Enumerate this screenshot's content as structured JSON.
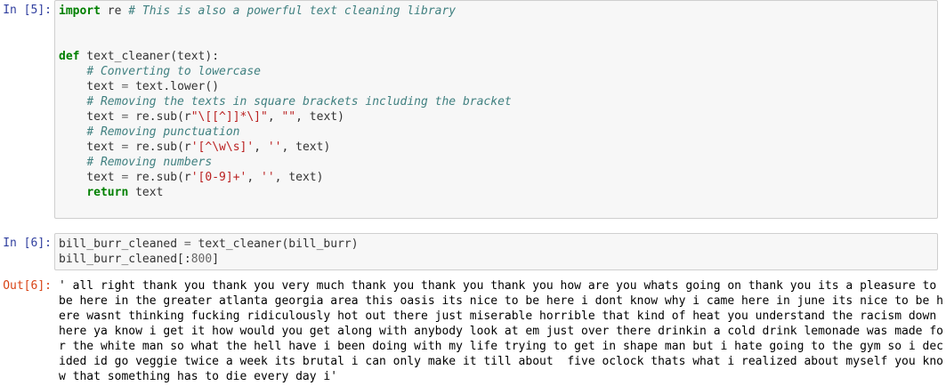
{
  "cells": [
    {
      "prompt": "In [5]:",
      "lines": [
        [
          {
            "t": "kw",
            "v": "import"
          },
          {
            "t": "",
            "v": " re "
          },
          {
            "t": "cm",
            "v": "# This is also a powerful text cleaning library"
          }
        ],
        [],
        [],
        [
          {
            "t": "kw",
            "v": "def"
          },
          {
            "t": "",
            "v": " text_cleaner(text):"
          }
        ],
        [
          {
            "t": "",
            "v": "    "
          },
          {
            "t": "cm",
            "v": "# Converting to lowercase"
          }
        ],
        [
          {
            "t": "",
            "v": "    text "
          },
          {
            "t": "op",
            "v": "="
          },
          {
            "t": "",
            "v": " text.lower()"
          }
        ],
        [
          {
            "t": "",
            "v": "    "
          },
          {
            "t": "cm",
            "v": "# Removing the texts in square brackets including the bracket"
          }
        ],
        [
          {
            "t": "",
            "v": "    text "
          },
          {
            "t": "op",
            "v": "="
          },
          {
            "t": "",
            "v": " re.sub(r"
          },
          {
            "t": "st",
            "v": "\"\\[[^]]*\\]\""
          },
          {
            "t": "",
            "v": ", "
          },
          {
            "t": "st",
            "v": "\"\""
          },
          {
            "t": "",
            "v": ", text)"
          }
        ],
        [
          {
            "t": "",
            "v": "    "
          },
          {
            "t": "cm",
            "v": "# Removing punctuation"
          }
        ],
        [
          {
            "t": "",
            "v": "    text "
          },
          {
            "t": "op",
            "v": "="
          },
          {
            "t": "",
            "v": " re.sub(r"
          },
          {
            "t": "st",
            "v": "'[^\\w\\s]'"
          },
          {
            "t": "",
            "v": ", "
          },
          {
            "t": "st",
            "v": "''"
          },
          {
            "t": "",
            "v": ", text)"
          }
        ],
        [
          {
            "t": "",
            "v": "    "
          },
          {
            "t": "cm",
            "v": "# Removing numbers"
          }
        ],
        [
          {
            "t": "",
            "v": "    text "
          },
          {
            "t": "op",
            "v": "="
          },
          {
            "t": "",
            "v": " re.sub(r"
          },
          {
            "t": "st",
            "v": "'[0-9]+'"
          },
          {
            "t": "",
            "v": ", "
          },
          {
            "t": "st",
            "v": "''"
          },
          {
            "t": "",
            "v": ", text)"
          }
        ],
        [
          {
            "t": "",
            "v": "    "
          },
          {
            "t": "kw",
            "v": "return"
          },
          {
            "t": "",
            "v": " text"
          }
        ],
        [],
        []
      ]
    },
    {
      "prompt": "In [6]:",
      "lines": [
        [
          {
            "t": "",
            "v": "bill_burr_cleaned "
          },
          {
            "t": "op",
            "v": "="
          },
          {
            "t": "",
            "v": " text_cleaner(bill_burr)"
          }
        ],
        [
          {
            "t": "",
            "v": "bill_burr_cleaned[:"
          },
          {
            "t": "nm",
            "v": "800"
          },
          {
            "t": "",
            "v": "]"
          }
        ]
      ]
    }
  ],
  "output": {
    "prompt": "Out[6]:",
    "lines": [
      "' all right thank you thank you very much thank you thank you thank you how are you whats going on thank you its a pleasure to",
      "be here in the greater atlanta georgia area this oasis its nice to be here i dont know why i came here in june its nice to be h",
      "ere wasnt thinking fucking ridiculously hot out there just miserable horrible that kind of heat you understand the racism down",
      "here ya know i get it how would you get along with anybody look at em just over there drinkin a cold drink lemonade was made fo",
      "r the white man so what the hell have i been doing with my life trying to get in shape man but i hate going to the gym so i dec",
      "ided id go veggie twice a week its brutal i can only make it till about  five oclock thats what i realized about myself you kno",
      "w that something has to die every day i'"
    ]
  }
}
